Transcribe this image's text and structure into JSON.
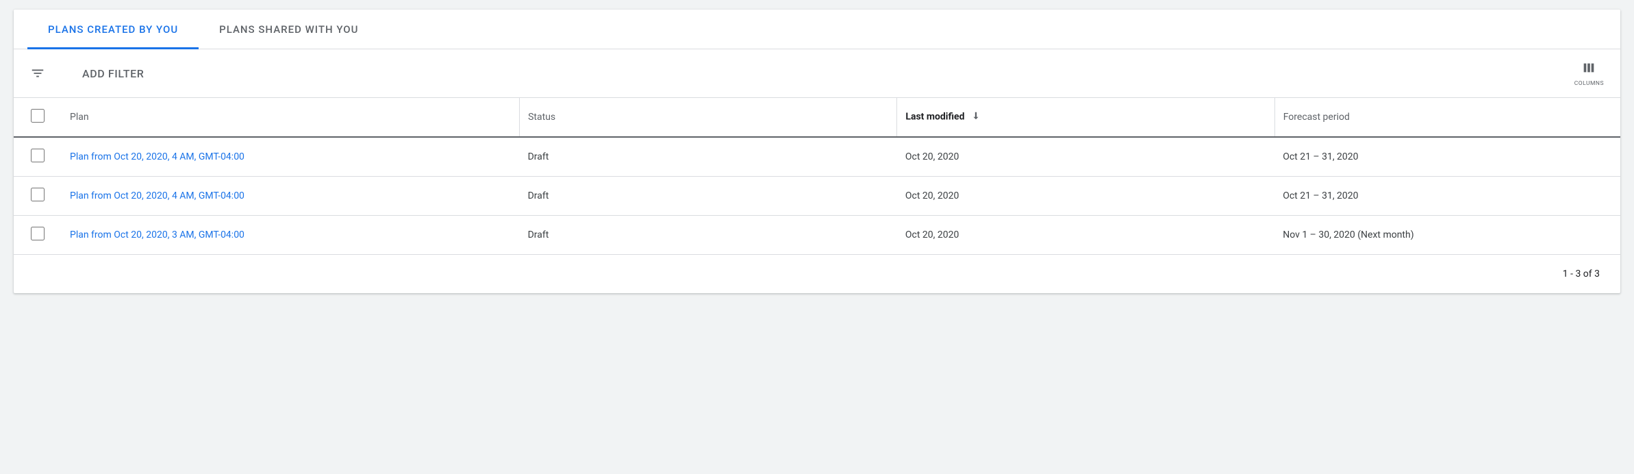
{
  "tabs": {
    "created": "PLANS CREATED BY YOU",
    "shared": "PLANS SHARED WITH YOU"
  },
  "filter": {
    "add_filter_label": "ADD FILTER",
    "columns_label": "COLUMNS"
  },
  "table": {
    "headers": {
      "plan": "Plan",
      "status": "Status",
      "last_modified": "Last modified",
      "forecast_period": "Forecast period"
    },
    "rows": [
      {
        "plan": "Plan from Oct 20, 2020, 4 AM, GMT-04:00",
        "status": "Draft",
        "last_modified": "Oct 20, 2020",
        "forecast_period": "Oct 21 – 31, 2020"
      },
      {
        "plan": "Plan from Oct 20, 2020, 4 AM, GMT-04:00",
        "status": "Draft",
        "last_modified": "Oct 20, 2020",
        "forecast_period": "Oct 21 – 31, 2020"
      },
      {
        "plan": "Plan from Oct 20, 2020, 3 AM, GMT-04:00",
        "status": "Draft",
        "last_modified": "Oct 20, 2020",
        "forecast_period": "Nov 1 – 30, 2020 (Next month)"
      }
    ]
  },
  "pagination": {
    "range_text": "1 - 3 of 3"
  },
  "colors": {
    "accent": "#1a73e8"
  }
}
